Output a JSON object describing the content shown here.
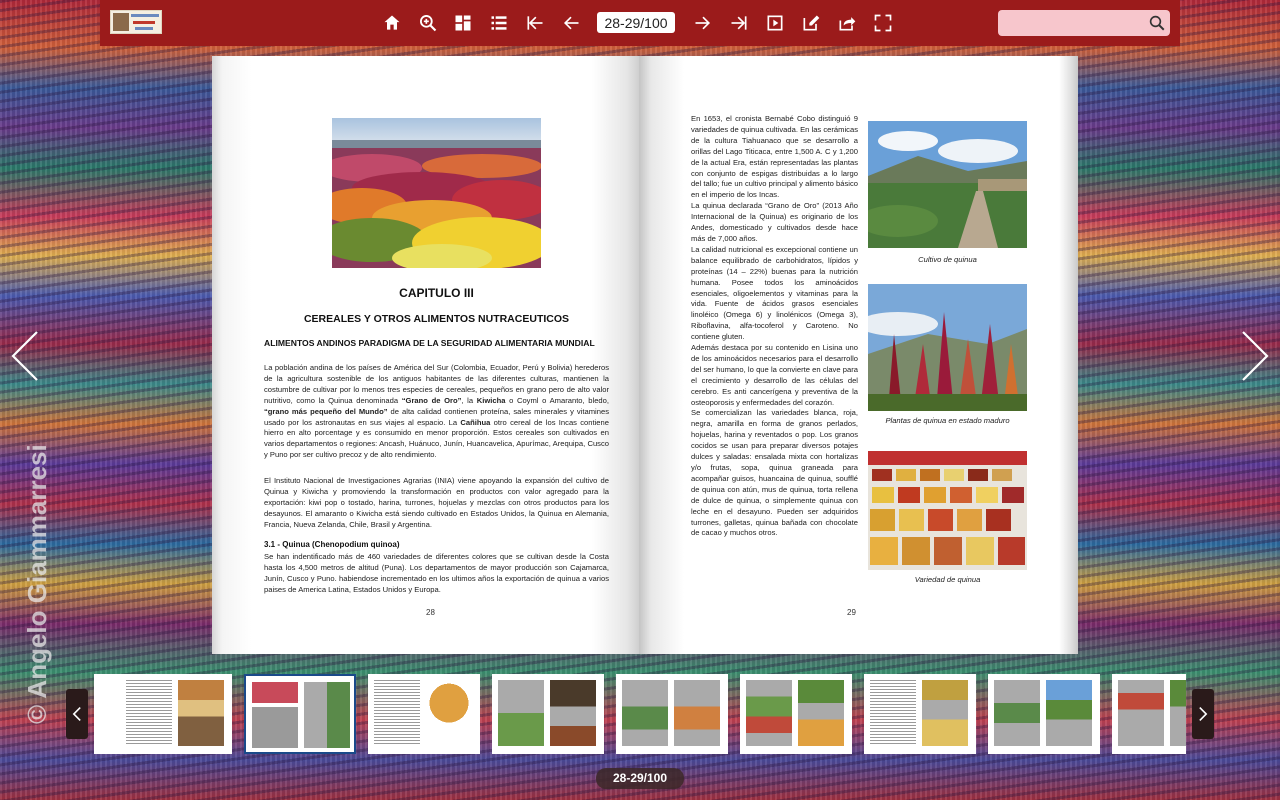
{
  "toolbar": {
    "page_field_value": "28-29/100",
    "search_placeholder": "",
    "icons": [
      "home-icon",
      "zoom-in-icon",
      "thumbnails-icon",
      "table-of-contents-icon",
      "first-page-icon",
      "previous-page-icon",
      "next-page-icon",
      "last-page-icon",
      "autoplay-icon",
      "notes-icon",
      "share-icon",
      "fullscreen-icon",
      "search-icon"
    ]
  },
  "book": {
    "left": {
      "chapter_title": "CAPITULO III",
      "chapter_subtitle": "CEREALES Y OTROS ALIMENTOS NUTRACEUTICOS",
      "section_title": "ALIMENTOS ANDINOS PARADIGMA DE LA SEGURIDAD ALIMENTARIA MUNDIAL",
      "para1_a": "La población andina de los países de América del Sur (Colombia, Ecuador, Perú y Bolivia) herederos de la agricultura sostenible de los antiguos habitantes de las diferentes culturas, mantienen la costumbre de cultivar por lo menos tres especies de cereales, pequeños en grano pero de alto valor nutritivo, como la Quinua denominada ",
      "para1_b": "“Grano de Oro”",
      "para1_c": ", la ",
      "para1_d": "Kiwicha",
      "para1_e": " o Coyml o Amaranto, bledo, ",
      "para1_f": "“grano más pequeño del Mundo”",
      "para1_g": " de alta calidad contienen proteína, sales minerales y vitamines usado por los astronautas en sus viajes al espacio. La ",
      "para1_h": "Cañihua",
      "para1_i": " otro cereal de los Incas contiene hierro en alto porcentage y es consumido en menor proporción. Estos cereales son cultivados en varios departamentos o regiones: Ancash, Huánuco, Junín, Huancavelica, Apurímac, Arequipa, Cusco y Puno por ser cultivo precoz y de alto rendimiento.",
      "para2": "El Instituto Nacional de Investigaciones Agrarias (INIA) viene apoyando la expansión del cultivo de Quinua y Kiwicha y promoviendo  la transformación en productos con valor agregado para la exportación: kiwi pop o tostado, harina, turrones, hojuelas y mezclas con otros productos para los desayunos. El amaranto o Kiwicha está siendo cultivado en Estados Unidos, la Quinua en Alemania, Francia, Nueva Zelanda, Chile, Brasil y Argentina.",
      "subsection_title": "3.1 - Quinua (Chenopodium quinoa)",
      "para3": "Se han indentificado más de 460 variedades de diferentes colores que se cultivan desde la Costa hasta los 4,500 metros de altitud (Puna). Los departamentos de mayor producción son Cajamarca,  Junín, Cusco y Puno. habiendose incrementado en los ultimos años la exportación de quinua a varios paises de America Latina, Estados Unidos y Europa.",
      "page_number": "28"
    },
    "right": {
      "para1": "En 1653, el cronista Bernabé Cobo distinguió 9 variedades de quinua cultivada. En las cerámicas de la cultura Tiahuanaco que se desarrollo a orillas del Lago Titicaca, entre 1,500 A. C y 1,200 de la actual Era, están representadas las plantas con conjunto de espigas distribuidas a lo largo del tallo; fue un cultivo principal y alimento básico en el imperio de los Incas.",
      "para2": "La quinua declarada “Grano de Oro” (2013 Año Internacional de la Quinua) es originario de los Andes, domesticado y cultivados desde hace más de 7,000 años.",
      "para3": "La calidad nutricional es excepcional contiene un balance equilibrado de carbohidratos, lípidos y proteínas (14 – 22%) buenas para la nutrición humana. Posee todos los aminoácidos esenciales, oligoelementos y vitaminas para la vida. Fuente de ácidos grasos esenciales linoléico (Omega 6) y linolénicos (Omega 3), Riboflavina, alfa-tocoferol y Caroteno. No contiene gluten.",
      "para4": "Además destaca por su contenido en Lisina uno de los aminoácidos necesarios para el desarrollo del ser humano, lo que la convierte en clave para el crecimiento y desarrollo de las células del cerebro. Es anti cancerígena  y preventiva de la osteoporosis y enfermedades del corazón.",
      "para5": "Se comercializan las variedades blanca, roja, negra, amarilla en forma de granos perlados, hojuelas, harina y reventados o pop. Los granos cocidos se usan para preparar diversos potajes dulces y saladas: ensalada mixta con hortalizas y/o frutas, sopa, quinua graneada  para acompañar guisos, huancaina de quinua, soufflé de quinua con atún, mus de quinua, torta rellena de dulce de quinua, o simplemente quinua con leche en el desayuno. Pueden ser adquiridos turrones, galletas, quinua bañada con chocolate de cacao y muchos otros.",
      "caption1": "Cultivo de quinua",
      "caption2": "Plantas de quinua en estado maduro",
      "caption3": "Variedad de quinua",
      "page_number": "29"
    }
  },
  "watermark": "© Angelo Giammarresi",
  "bottom_indicator": "28-29/100",
  "thumbnails": {
    "count": 10,
    "active_index": 2
  },
  "colors": {
    "toolbar": "#9b1b1b",
    "search_bg": "#f7c6cc",
    "active_thumb_border": "#1a4a8a"
  }
}
